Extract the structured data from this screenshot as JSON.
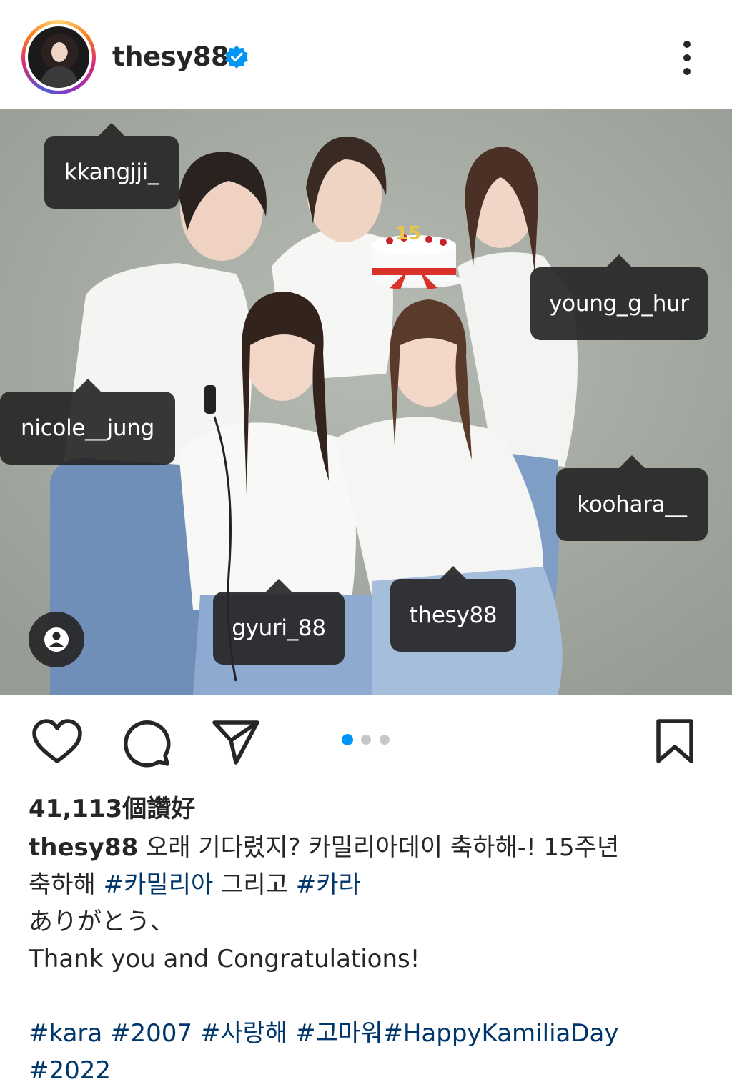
{
  "header": {
    "username": "thesy88",
    "verified_icon": "verified-badge-icon",
    "more_icon": "more-vertical-icon",
    "avatar_ring_colors": [
      "#feda75",
      "#fa7e1e",
      "#d62976",
      "#962fbf",
      "#4f5bd5"
    ]
  },
  "photo": {
    "tags": [
      {
        "username": "kkangjji_"
      },
      {
        "username": "young_g_hur"
      },
      {
        "username": "nicole__jung"
      },
      {
        "username": "koohara__"
      },
      {
        "username": "gyuri_88"
      },
      {
        "username": "thesy88"
      }
    ],
    "tags_icon": "user-tags-icon",
    "cake_candle_text": "15"
  },
  "actions": {
    "like_icon": "heart-icon",
    "comment_icon": "comment-icon",
    "share_icon": "send-icon",
    "save_icon": "bookmark-icon",
    "carousel": {
      "count": 3,
      "active_index": 0,
      "active_color": "#0095f6",
      "inactive_color": "#c7c7c7"
    }
  },
  "post": {
    "likes": "41,113個讚好",
    "caption_user": "thesy88",
    "caption_line1": "오래 기다렸지? 카밀리아데이 축하해-! 15주년",
    "caption_line2_text1": "축하해 ",
    "caption_line2_tag1": "#카밀리아",
    "caption_line2_text2": " 그리고 ",
    "caption_line2_tag2": "#카라",
    "caption_line3": "ありがとう、",
    "caption_line4": "Thank you and Congratulations!",
    "hashtags_line1": [
      "#kara",
      "#2007",
      "#사랑해",
      "#고마워",
      "#HappyKamiliaDay"
    ],
    "hashtags_line2": [
      "#2022"
    ],
    "hashtag_color": "#00376b"
  }
}
